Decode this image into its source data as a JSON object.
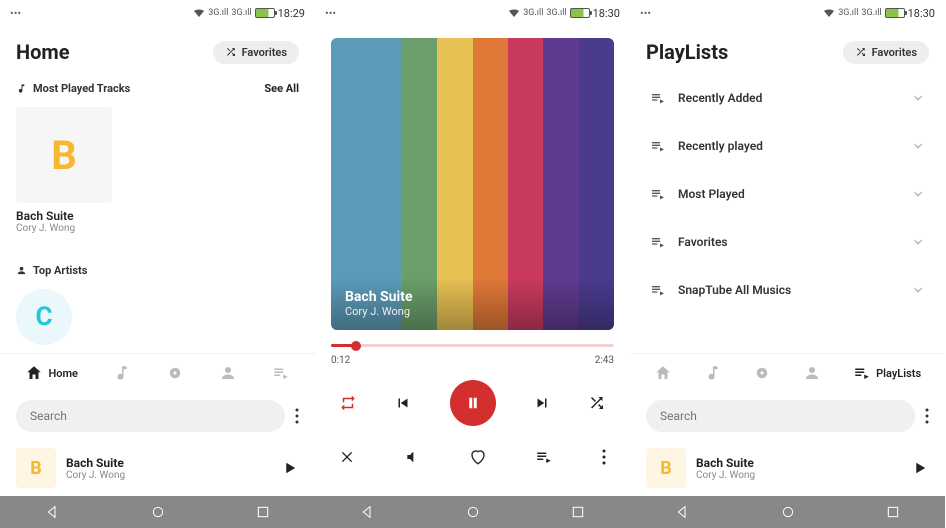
{
  "status": {
    "time1": "18:29",
    "time2": "18:30",
    "time3": "18:30",
    "sig": "3G"
  },
  "home": {
    "title": "Home",
    "favorites_label": "Favorites",
    "section_most_played": "Most Played Tracks",
    "see_all": "See All",
    "track_letter": "B",
    "track_title": "Bach Suite",
    "track_artist": "Cory J. Wong",
    "section_top_artists": "Top Artists",
    "artist_letter": "C",
    "tab_home": "Home",
    "search_placeholder": "Search",
    "np_letter": "B",
    "np_title": "Bach Suite",
    "np_artist": "Cory J. Wong"
  },
  "player": {
    "title": "Bach Suite",
    "artist": "Cory J. Wong",
    "elapsed": "0:12",
    "total": "2:43",
    "stripes": [
      "#5b9bb8",
      "#5b9bb8",
      "#6a9e6a",
      "#e8c154",
      "#e07838",
      "#c93a5e",
      "#5e3b8e",
      "#4a3b8e"
    ]
  },
  "playlists": {
    "title": "PlayLists",
    "favorites_label": "Favorites",
    "items": [
      "Recently Added",
      "Recently played",
      "Most Played",
      "Favorites",
      "SnapTube All Musics"
    ],
    "tab_label": "PlayLists",
    "search_placeholder": "Search",
    "np_letter": "B",
    "np_title": "Bach Suite",
    "np_artist": "Cory J. Wong"
  }
}
